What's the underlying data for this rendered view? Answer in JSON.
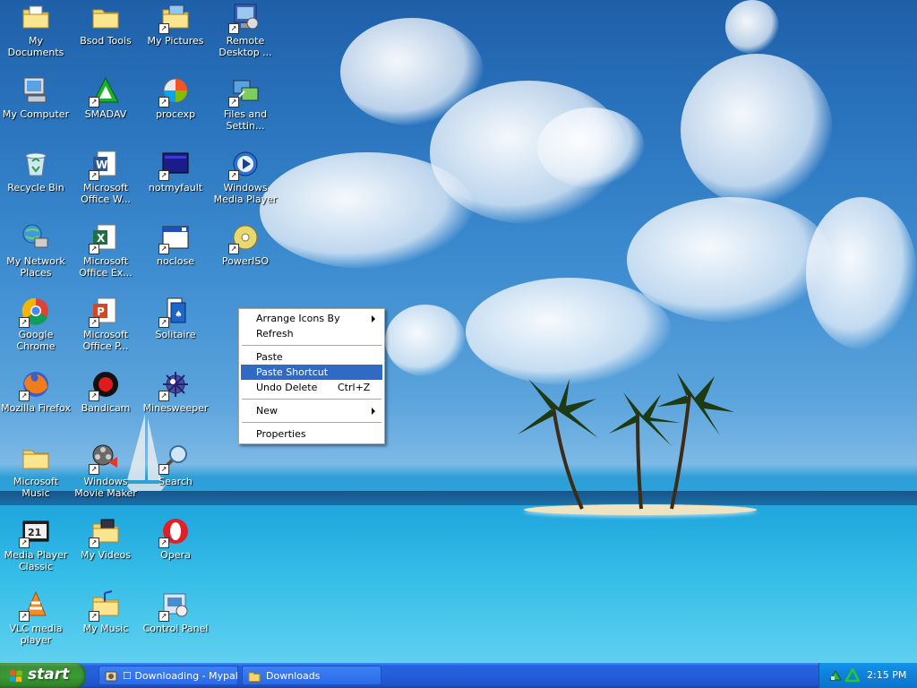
{
  "desktop": {
    "icons": [
      {
        "label": "My Documents",
        "icon": "my-documents-icon"
      },
      {
        "label": "Bsod Tools",
        "icon": "folder-icon"
      },
      {
        "label": "My Pictures",
        "icon": "my-pictures-icon"
      },
      {
        "label": "Remote Desktop ...",
        "icon": "remote-desktop-icon"
      },
      {
        "label": "My Computer",
        "icon": "my-computer-icon"
      },
      {
        "label": "SMADAV",
        "icon": "smadav-icon"
      },
      {
        "label": "procexp",
        "icon": "procexp-icon"
      },
      {
        "label": "Files and Settin...",
        "icon": "files-settings-icon"
      },
      {
        "label": "Recycle Bin",
        "icon": "recycle-bin-icon"
      },
      {
        "label": "Microsoft Office W...",
        "icon": "word-icon"
      },
      {
        "label": "notmyfault",
        "icon": "notmyfault-icon"
      },
      {
        "label": "Windows Media Player",
        "icon": "media-player-icon"
      },
      {
        "label": "My Network Places",
        "icon": "network-places-icon"
      },
      {
        "label": "Microsoft Office Ex...",
        "icon": "excel-icon"
      },
      {
        "label": "noclose",
        "icon": "window-icon"
      },
      {
        "label": "PowerISO",
        "icon": "poweriso-icon"
      },
      {
        "label": "Google Chrome",
        "icon": "chrome-icon"
      },
      {
        "label": "Microsoft Office P...",
        "icon": "powerpoint-icon"
      },
      {
        "label": "Solitaire",
        "icon": "solitaire-icon"
      },
      {
        "label": "Mozilla Firefox",
        "icon": "firefox-icon"
      },
      {
        "label": "Bandicam",
        "icon": "bandicam-icon"
      },
      {
        "label": "Minesweeper",
        "icon": "minesweeper-icon"
      },
      {
        "label": "Microsoft Music",
        "icon": "folder-icon"
      },
      {
        "label": "Windows Movie Maker",
        "icon": "movie-maker-icon"
      },
      {
        "label": "Search",
        "icon": "search-icon"
      },
      {
        "label": "Media Player Classic",
        "icon": "mpc-icon"
      },
      {
        "label": "My Videos",
        "icon": "my-videos-icon"
      },
      {
        "label": "Opera",
        "icon": "opera-icon"
      },
      {
        "label": "VLC media player",
        "icon": "vlc-icon"
      },
      {
        "label": "My Music",
        "icon": "my-music-icon"
      },
      {
        "label": "Control Panel",
        "icon": "control-panel-icon"
      }
    ]
  },
  "context_menu": {
    "arrange": "Arrange Icons By",
    "refresh": "Refresh",
    "paste": "Paste",
    "paste_shortcut": "Paste Shortcut",
    "undo_delete": "Undo Delete",
    "undo_shortcut": "Ctrl+Z",
    "new": "New",
    "properties": "Properties",
    "highlighted": "Paste Shortcut"
  },
  "taskbar": {
    "start_label": "start",
    "buttons": [
      {
        "label": "☐ Downloading - Mypal",
        "icon": "mypal-icon"
      },
      {
        "label": "Downloads",
        "icon": "folder-icon"
      }
    ],
    "clock": "2:15 PM"
  },
  "colors": {
    "menu_highlight": "#316ac5",
    "taskbar_blue": "#245edb",
    "start_green": "#3a9b33"
  }
}
